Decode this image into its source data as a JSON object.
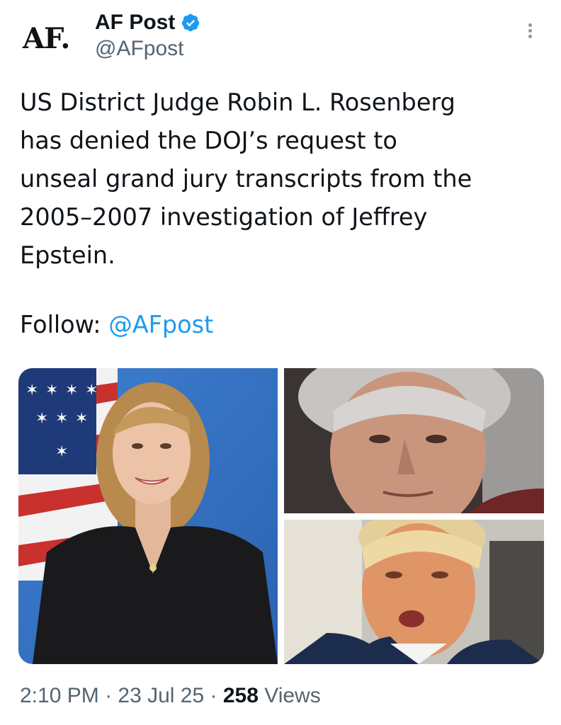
{
  "author": {
    "avatar_text": "AF.",
    "display_name": "AF Post",
    "handle": "@AFpost",
    "verified": true
  },
  "tweet": {
    "text": "US District Judge Robin L. Rosenberg\nhas denied the DOJ’s request to\nunseal grand jury transcripts from the\n2005–2007 investigation of Jeffrey\nEpstein.",
    "follow_label": "Follow: ",
    "follow_mention": "@AFpost"
  },
  "media": {
    "images": [
      "judge-portrait",
      "man-gray-hair-portrait",
      "man-speaking-portrait"
    ]
  },
  "meta": {
    "time": "2:10 PM",
    "sep1": " · ",
    "date": "23 Jul 25",
    "sep2": " · ",
    "views_count": "258",
    "views_label": " Views"
  },
  "colors": {
    "link": "#1d9bf0",
    "verified": "#1d9bf0",
    "text": "#0f1419",
    "secondary": "#536471"
  }
}
